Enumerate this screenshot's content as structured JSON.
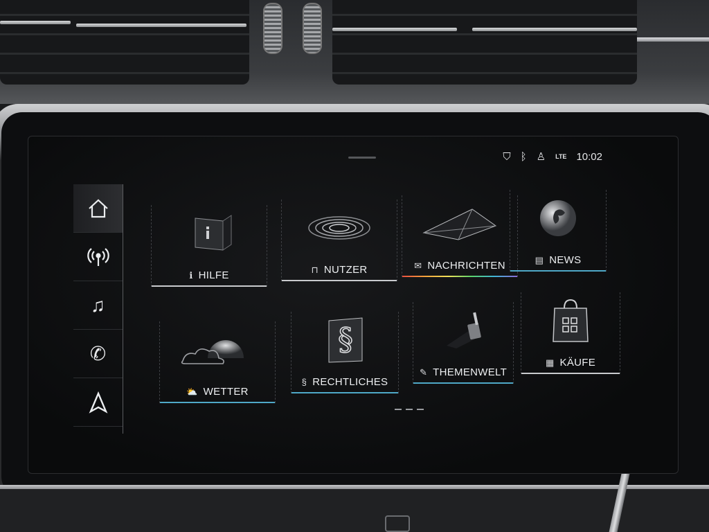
{
  "status_bar": {
    "time": "10:02",
    "icons": [
      "shield-location-icon",
      "bluetooth-icon",
      "user-icon",
      "lte-signal-icon"
    ],
    "lte_label": "LTE"
  },
  "side_nav": {
    "items": [
      {
        "name": "home",
        "icon": "home-icon",
        "active": true
      },
      {
        "name": "radio",
        "icon": "radio-broadcast-icon",
        "active": false
      },
      {
        "name": "media",
        "icon": "music-note-icon",
        "active": false
      },
      {
        "name": "phone",
        "icon": "phone-icon",
        "active": false
      },
      {
        "name": "navigation",
        "icon": "navigation-arrow-icon",
        "active": false
      }
    ]
  },
  "apps": [
    {
      "label": "HILFE",
      "icon": "info-icon",
      "glyph": "ℹ",
      "accent": "#c9cbce"
    },
    {
      "label": "NUTZER",
      "icon": "user-lock-icon",
      "glyph": "🔒",
      "accent": "#c9cbce"
    },
    {
      "label": "NACHRICHTEN",
      "icon": "envelope-icon",
      "glyph": "✉",
      "accent": "gradient-rainbow"
    },
    {
      "label": "NEWS",
      "icon": "newspaper-icon",
      "glyph": "▤",
      "accent": "#4fa9c8"
    },
    {
      "label": "WETTER",
      "icon": "weather-sun-cloud-icon",
      "glyph": "⛅",
      "accent": "#4fa9c8"
    },
    {
      "label": "RECHTLICHES",
      "icon": "paragraph-icon",
      "glyph": "§",
      "accent": "#4fa9c8"
    },
    {
      "label": "THEMENWELT",
      "icon": "brush-icon",
      "glyph": "✎",
      "accent": "#4fa9c8"
    },
    {
      "label": "KÄUFE",
      "icon": "store-grid-icon",
      "glyph": "▦",
      "accent": "#c9cbce"
    }
  ],
  "pager": {
    "pages": 3
  }
}
